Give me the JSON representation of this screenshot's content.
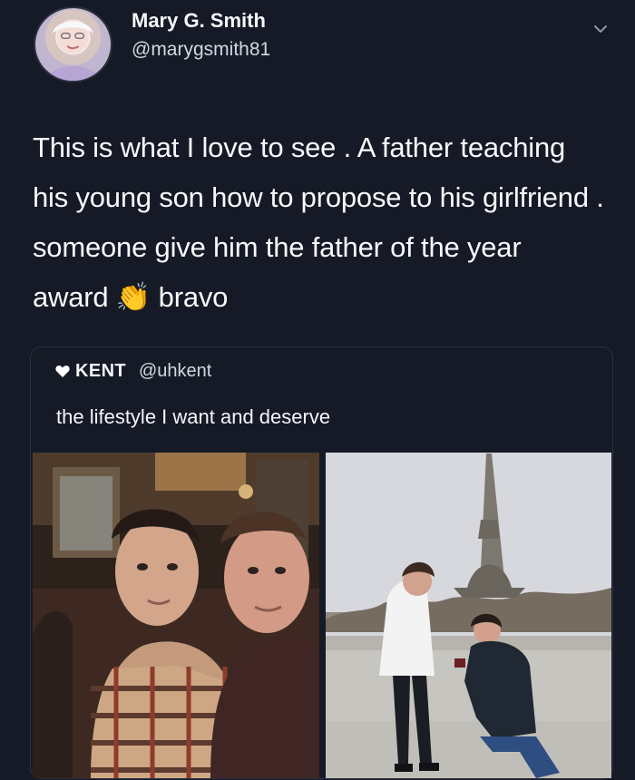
{
  "tweet": {
    "name": "Mary G. Smith",
    "handle": "@marygsmith81",
    "text": "This is what I love to see . A father teaching his young son how to propose to his girlfriend . someone give him the father of the year award 👏 bravo",
    "menu_icon": "chevron-down-icon"
  },
  "quoted_tweet": {
    "name": "KENT",
    "handle": "@uhkent",
    "text": "the lifestyle I want and deserve",
    "name_icon": "heart-icon"
  },
  "colors": {
    "background": "#151a26",
    "text": "#f2f4f8",
    "secondary_text": "#d2d8e3"
  }
}
